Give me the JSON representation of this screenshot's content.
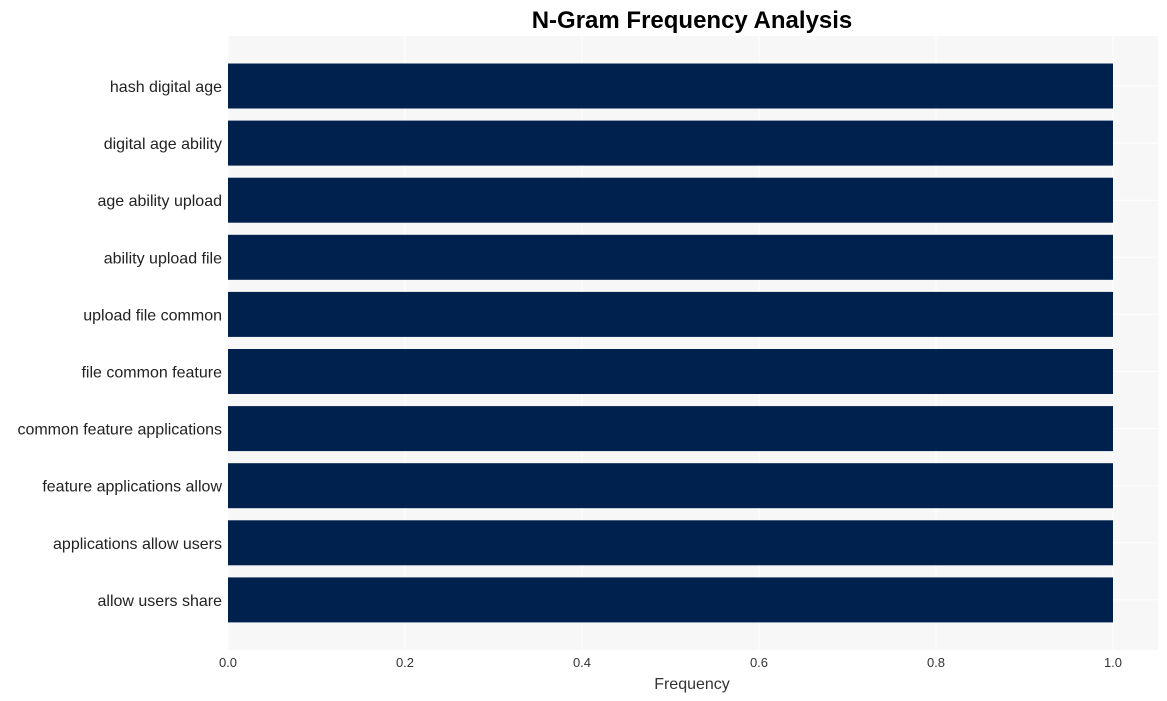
{
  "chart_data": {
    "type": "bar",
    "orientation": "horizontal",
    "title": "N-Gram Frequency Analysis",
    "xlabel": "Frequency",
    "ylabel": "",
    "categories": [
      "hash digital age",
      "digital age ability",
      "age ability upload",
      "ability upload file",
      "upload file common",
      "file common feature",
      "common feature applications",
      "feature applications allow",
      "applications allow users",
      "allow users share"
    ],
    "values": [
      1,
      1,
      1,
      1,
      1,
      1,
      1,
      1,
      1,
      1
    ],
    "xlim": [
      0,
      1.05
    ],
    "xticks": [
      "0.0",
      "0.2",
      "0.4",
      "0.6",
      "0.8",
      "1.0"
    ],
    "xtick_values": [
      0,
      0.2,
      0.4,
      0.6,
      0.8,
      1.0
    ],
    "grid": true,
    "legend": "none",
    "colors": {
      "bar": "#00204e",
      "plot_background": "#f7f7f7",
      "grid": "#ffffff"
    }
  }
}
